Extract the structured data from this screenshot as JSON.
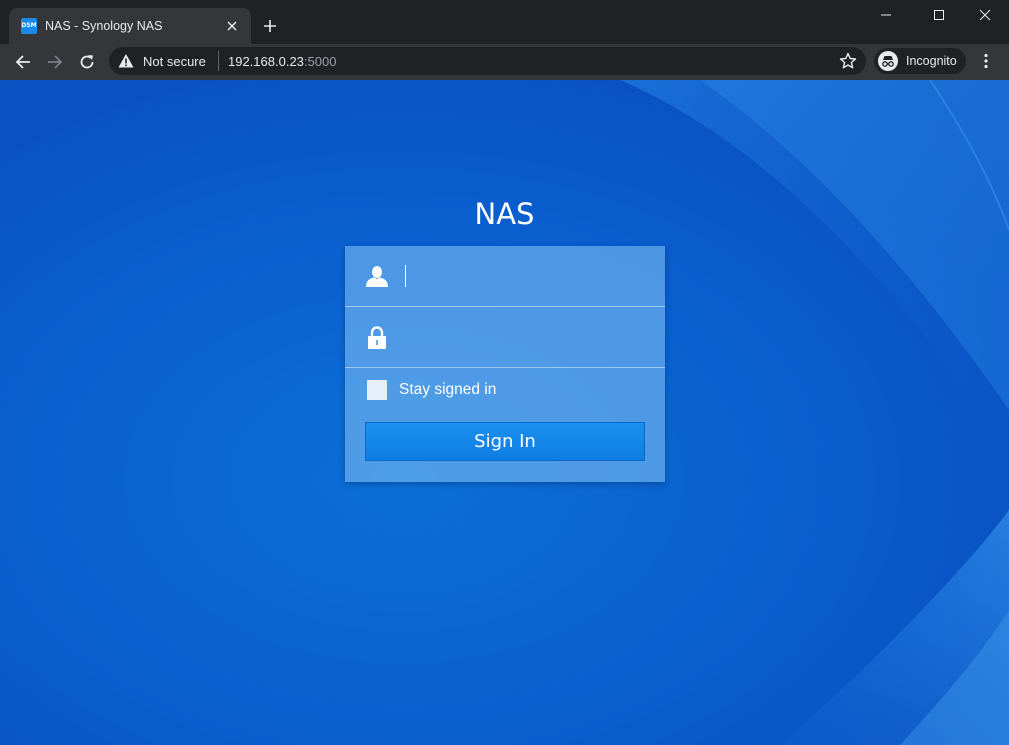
{
  "browser": {
    "tab_title": "NAS - Synology NAS",
    "favicon_text": "DSM",
    "security_label": "Not secure",
    "url_host": "192.168.0.23",
    "url_port": ":5000",
    "profile_label": "Incognito"
  },
  "login": {
    "title": "NAS",
    "username_value": "",
    "password_value": "",
    "stay_signed_in_label": "Stay signed in",
    "stay_signed_in_checked": false,
    "sign_in_label": "Sign In"
  },
  "colors": {
    "accent": "#1a8ae6",
    "background": "#0a5fcf"
  }
}
